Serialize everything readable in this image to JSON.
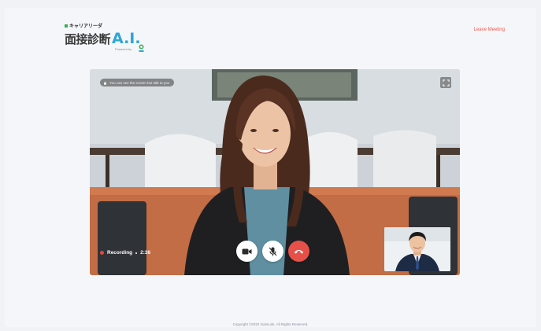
{
  "brand": {
    "small_text": "キャリアリーダ",
    "title_jp": "面接診断",
    "title_ai": "A.I.",
    "powered_by": "Powered by",
    "accent": "#2ea6d8"
  },
  "header": {
    "leave_label": "Leave Meeting",
    "leave_color": "#e8584e"
  },
  "video": {
    "notice_text": "You can see the screen but talk to you",
    "fullscreen_icon": "expand-icon",
    "recording_label": "Recording",
    "recording_time": "2:36",
    "controls": [
      {
        "name": "camera-button",
        "icon": "video-camera-icon"
      },
      {
        "name": "mute-button",
        "icon": "microphone-off-icon"
      },
      {
        "name": "hang-up-button",
        "icon": "phone-hangup-icon",
        "color": "#e65048"
      }
    ]
  },
  "footer": {
    "copyright": "Copyright ©2022 GainLink. All Rights Reserved."
  }
}
